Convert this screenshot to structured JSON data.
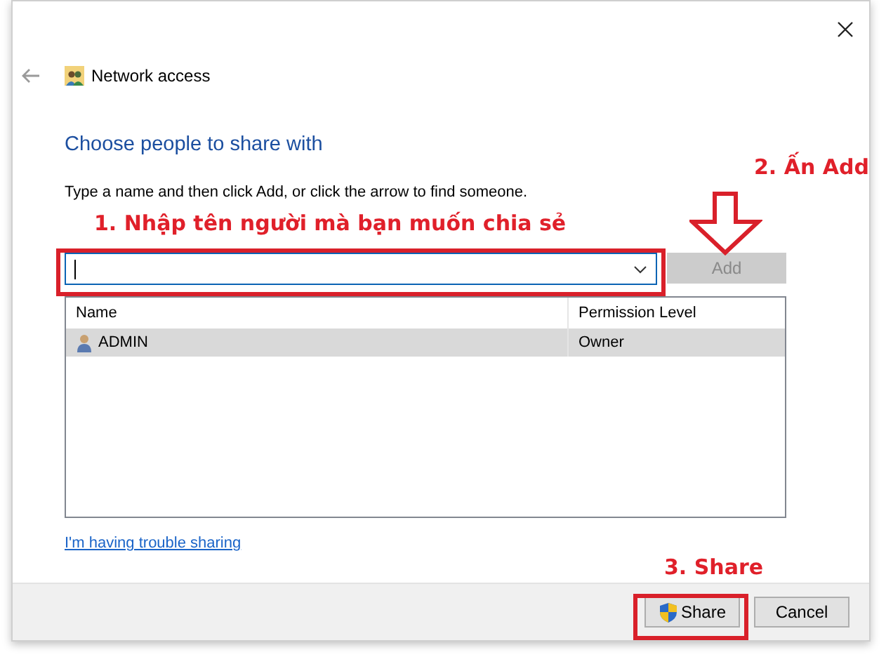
{
  "window": {
    "title": "Network access"
  },
  "heading": "Choose people to share with",
  "instructions": "Type a name and then click Add, or click the arrow to find someone.",
  "add_button": {
    "label": "Add",
    "disabled": true
  },
  "table": {
    "columns": [
      "Name",
      "Permission Level"
    ],
    "rows": [
      {
        "name": "ADMIN",
        "permission": "Owner",
        "selected": true
      }
    ]
  },
  "help_link": "I'm having trouble sharing",
  "buttons": [
    {
      "label": "Share",
      "kind": "shield"
    },
    {
      "label": "Cancel",
      "kind": "plain"
    }
  ],
  "annotations": [
    {
      "text": "1. Nhập tên người mà bạn muốn chia sẻ"
    },
    {
      "text": "2. Ấn Add"
    },
    {
      "text": "3. Share"
    }
  ]
}
